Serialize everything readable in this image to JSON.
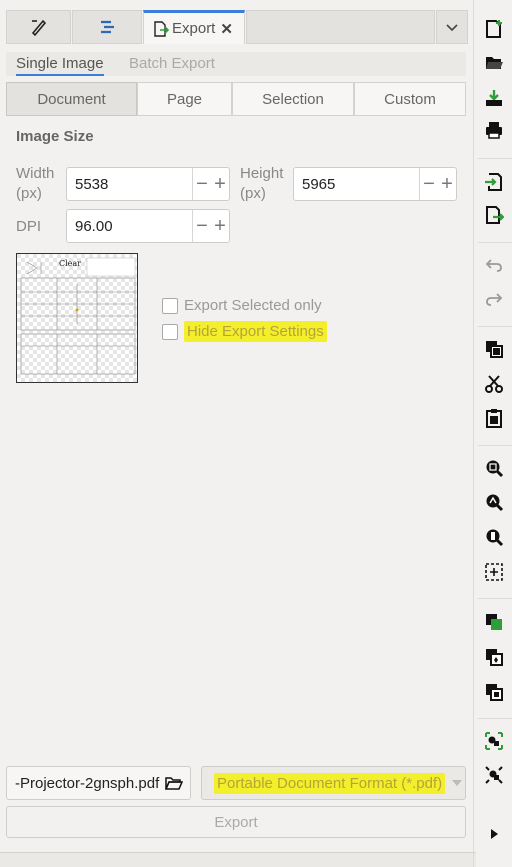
{
  "tabs": {
    "export_label": "Export",
    "close_glyph": "✕"
  },
  "subtabs": {
    "single": "Single Image",
    "batch": "Batch Export"
  },
  "area": [
    "Document",
    "Page",
    "Selection",
    "Custom"
  ],
  "image_size": {
    "title": "Image Size",
    "width_label_1": "Width",
    "width_label_2": "(px)",
    "width_value": "5538",
    "height_label_1": "Height",
    "height_label_2": "(px)",
    "height_value": "5965",
    "dpi_label": "DPI",
    "dpi_value": "96.00"
  },
  "options": {
    "export_selected_only": "Export Selected only",
    "hide_export_settings": "Hide Export Settings"
  },
  "preview": {
    "title": "Clear"
  },
  "bottom": {
    "filename": "-Projector-2gnsph.pdf",
    "format": "Portable Document Format (*.pdf)",
    "export_button": "Export"
  },
  "colors": {
    "accent": "#3b7ed8",
    "highlight": "#f3ef2a",
    "toolbar_green": "#2e9e3a"
  }
}
